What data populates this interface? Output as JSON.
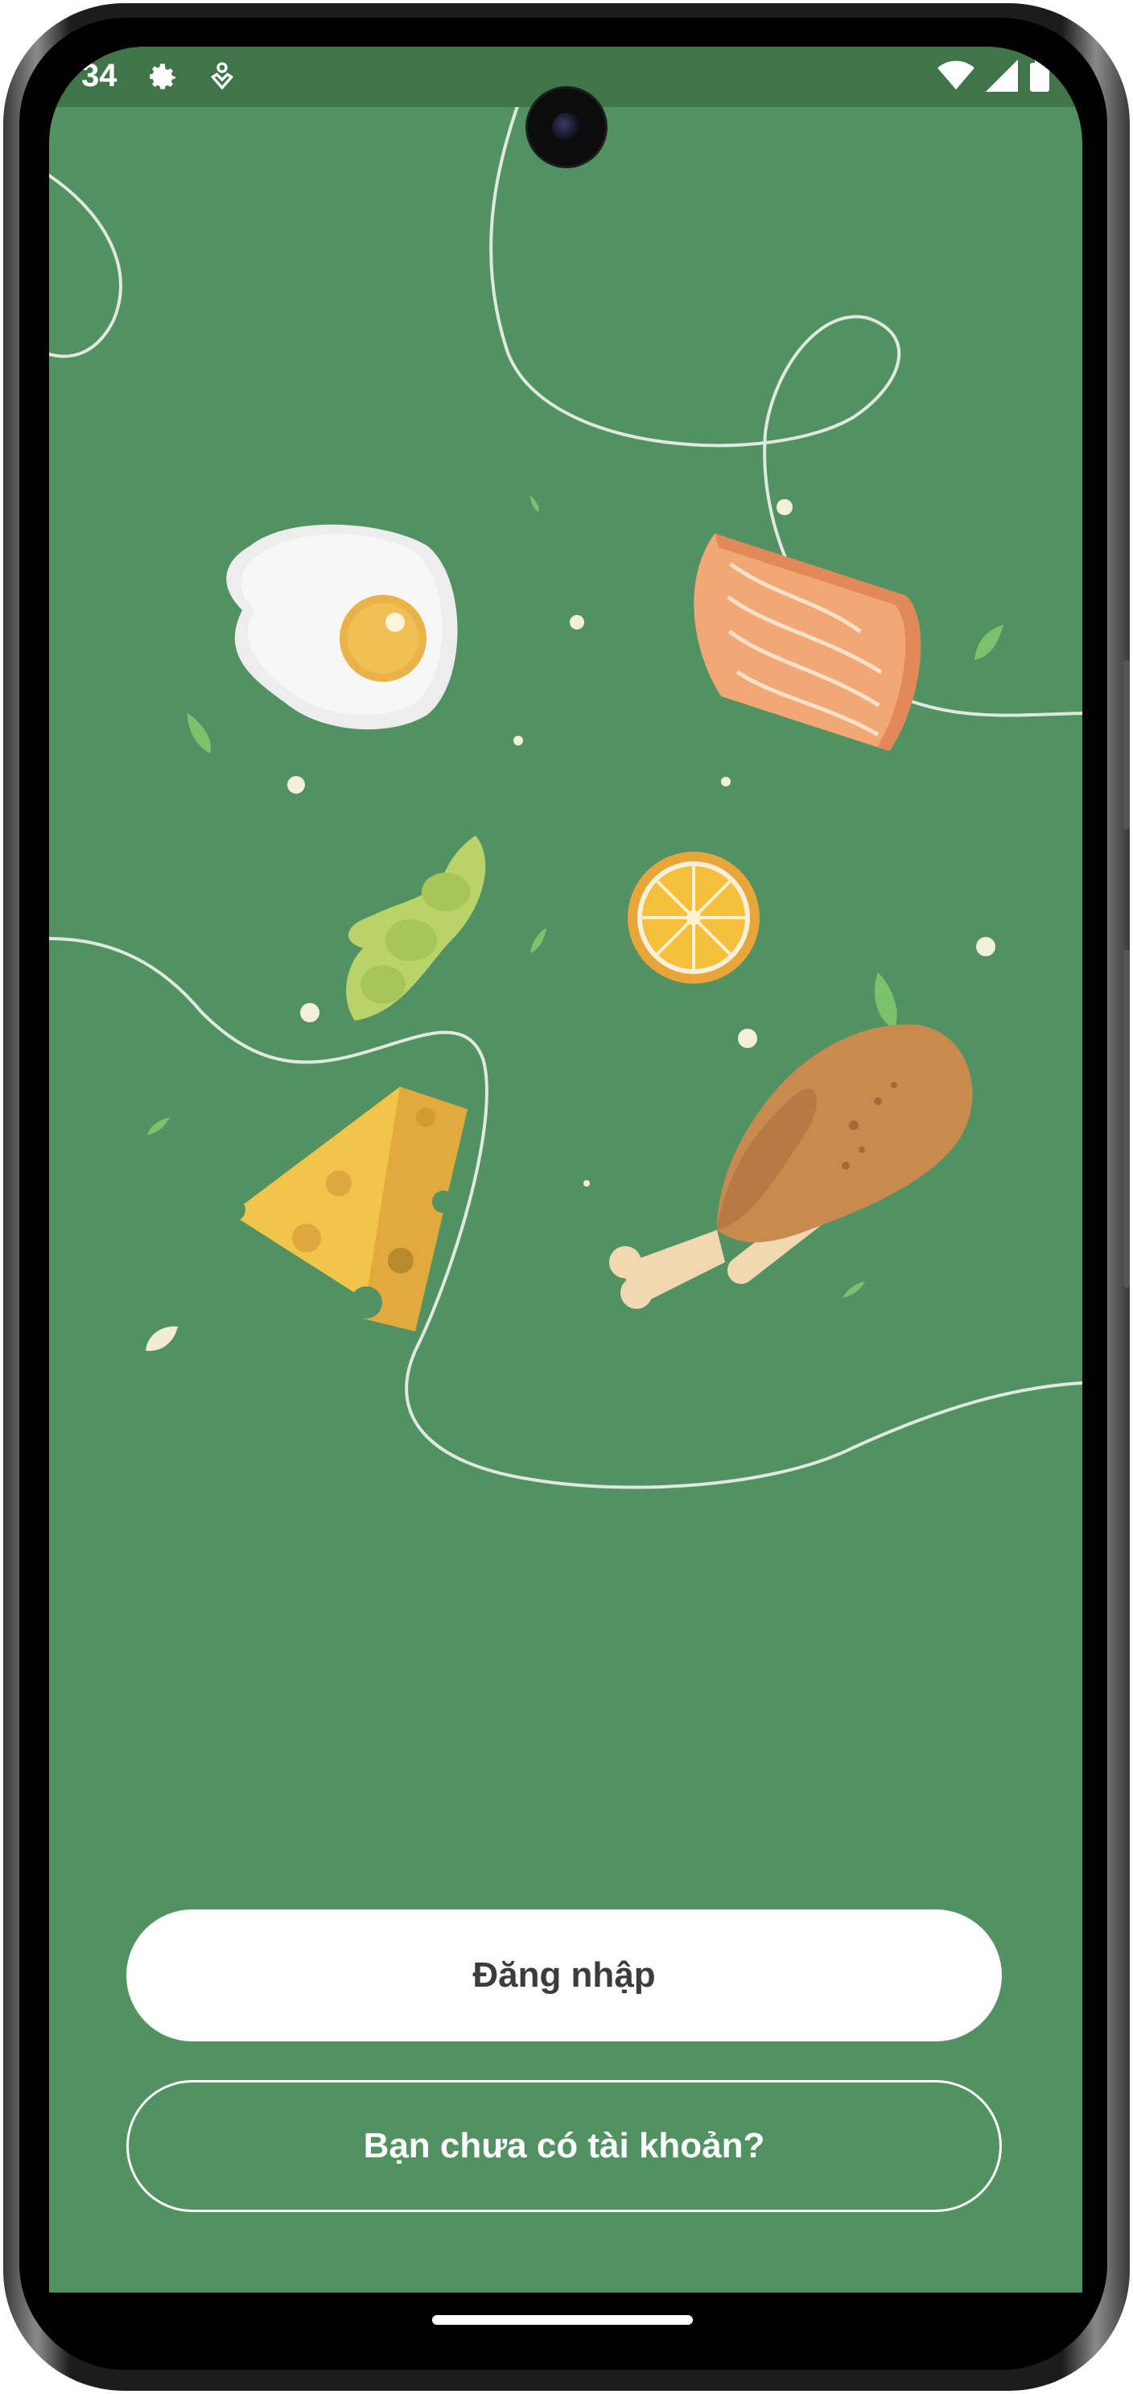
{
  "status_bar": {
    "time": "34",
    "left_icons": [
      "gear-icon",
      "account-badge-icon"
    ],
    "right_icons": [
      "wifi-icon",
      "cellular-signal-icon",
      "battery-icon"
    ]
  },
  "illustration": {
    "foods": [
      "egg-icon",
      "salmon-icon",
      "edamame-icon",
      "lemon-slice-icon",
      "cheese-icon",
      "chicken-drumstick-icon"
    ]
  },
  "actions": {
    "login_label": "Đăng nhập",
    "register_label": "Bạn chưa có tài khoản?"
  },
  "colors": {
    "background": "#529262",
    "status_bar": "#3f7549",
    "button_fill": "#ffffff",
    "button_text": "#3c3c3c"
  }
}
